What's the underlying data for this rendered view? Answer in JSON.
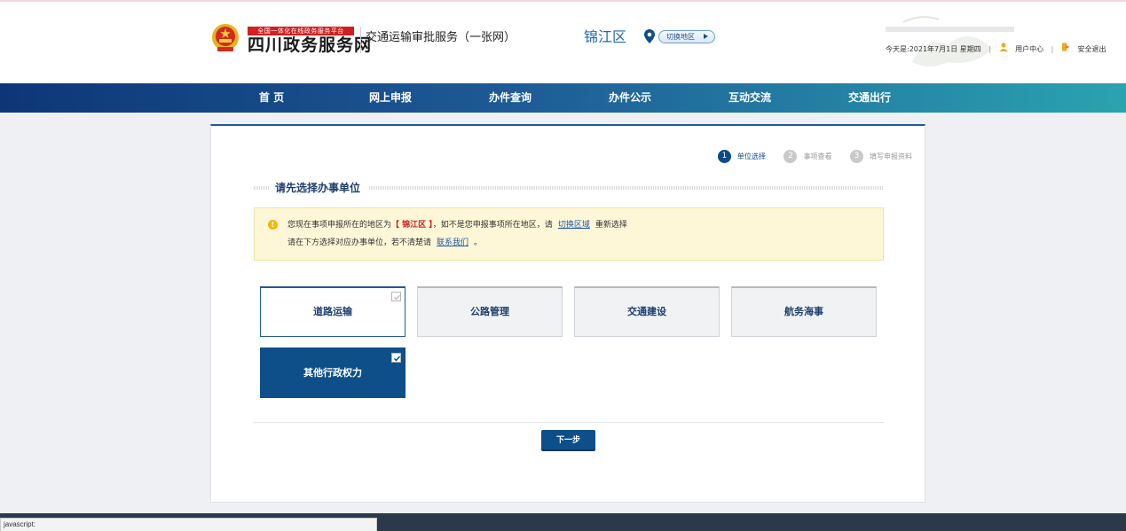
{
  "header": {
    "logo_badge": "全国一体化在线政务服务平台",
    "logo_main": "四川政务服务网",
    "service_title": "交通运输审批服务（一张网）",
    "region_name": "锦江区",
    "switch_region_label": "切换地区",
    "date_text": "今天是:2021年7月1日 星期四",
    "user_center": "用户中心",
    "logout": "安全退出"
  },
  "nav": {
    "items": [
      "首 页",
      "网上申报",
      "办件查询",
      "办件公示",
      "互动交流",
      "交通出行"
    ]
  },
  "steps": [
    {
      "num": "1",
      "label": "单位选择",
      "active": true
    },
    {
      "num": "2",
      "label": "事项查看",
      "active": false
    },
    {
      "num": "3",
      "label": "填写申报资料",
      "active": false
    }
  ],
  "section_title": "请先选择办事单位",
  "notice": {
    "line1_prefix": "您现在事项申报所在的地区为",
    "region_highlight": "【 锦江区 】",
    "line1_middle": "，如不是您申报事项所在地区，请",
    "switch_link": "切换区域",
    "line1_suffix": "重新选择",
    "line2_prefix": "请在下方选择对应办事单位，若不清楚请",
    "contact_link": "联系我们",
    "line2_suffix": "。"
  },
  "options": [
    {
      "label": "道路运输",
      "state": "hover"
    },
    {
      "label": "公路管理",
      "state": "normal"
    },
    {
      "label": "交通建设",
      "state": "normal"
    },
    {
      "label": "航务海事",
      "state": "normal"
    },
    {
      "label": "其他行政权力",
      "state": "selected"
    }
  ],
  "next_button": "下一步",
  "status_bar": "javascript:",
  "colors": {
    "primary": "#0f4f89",
    "nav_start": "#0d3679",
    "nav_end": "#2aa3b0",
    "highlight_red": "#d31f1f",
    "notice_bg": "#fdf7d8"
  },
  "icons": [
    "national-emblem-icon",
    "location-pin-icon",
    "user-icon",
    "logout-icon",
    "warning-icon",
    "checkbox-icon"
  ]
}
